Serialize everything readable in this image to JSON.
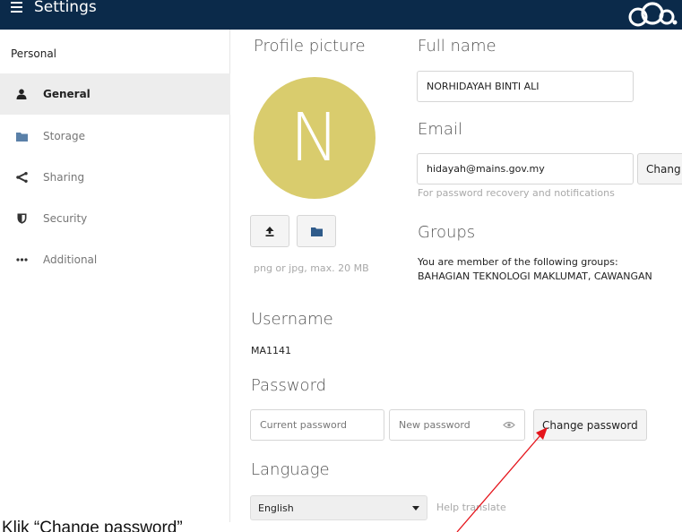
{
  "header": {
    "title": "Settings",
    "menu_icon": "hamburger-menu-icon",
    "logo_icon": "cloud-logo-icon",
    "background": "#0b2a4a"
  },
  "sidebar": {
    "section": "Personal",
    "items": [
      {
        "label": "General",
        "icon": "user-icon",
        "active": true
      },
      {
        "label": "Storage",
        "icon": "folder-icon"
      },
      {
        "label": "Sharing",
        "icon": "share-icon"
      },
      {
        "label": "Security",
        "icon": "shield-icon"
      },
      {
        "label": "Additional",
        "icon": "more-icon"
      }
    ]
  },
  "profile": {
    "picture_label": "Profile picture",
    "avatar_letter": "N",
    "avatar_color": "#d9cc6d",
    "upload_icon": "upload-icon",
    "folder_icon": "folder-icon",
    "hint": "png or jpg, max. 20 MB"
  },
  "fullname": {
    "label": "Full name",
    "value": "NORHIDAYAH BINTI ALI"
  },
  "email": {
    "label": "Email",
    "value": "hidayah@mains.gov.my",
    "change_button": "Chang",
    "hint": "For password recovery and notifications"
  },
  "groups": {
    "label": "Groups",
    "line1": "You are member of the following groups:",
    "line2": "BAHAGIAN TEKNOLOGI MAKLUMAT, CAWANGAN"
  },
  "username": {
    "label": "Username",
    "value": "MA1141"
  },
  "password": {
    "label": "Password",
    "current_placeholder": "Current password",
    "new_placeholder": "New password",
    "show_icon": "eye-icon",
    "change_button": "Change password"
  },
  "language": {
    "label": "Language",
    "selected": "English",
    "help_link": "Help translate"
  },
  "annotation": {
    "caption": "Klik “Change password”",
    "arrow_color": "#e5141b"
  }
}
